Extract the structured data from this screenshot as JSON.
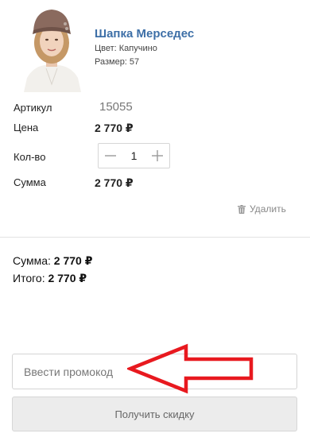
{
  "product": {
    "title": "Шапка Мерседес",
    "color": "Цвет: Капучино",
    "size": "Размер: 57"
  },
  "details": {
    "article_label": "Артикул",
    "article_value": "15055",
    "price_label": "Цена",
    "price_value": "2 770 ₽",
    "qty_label": "Кол-во",
    "qty_value": "1",
    "sum_label": "Сумма",
    "sum_value": "2 770 ₽"
  },
  "delete_label": "Удалить",
  "totals": {
    "sum_label": "Сумма:",
    "sum_value": "2 770 ₽",
    "total_label": "Итого:",
    "total_value": "2 770 ₽"
  },
  "promo": {
    "placeholder": "Ввести промокод",
    "button_label": "Получить скидку"
  },
  "colors": {
    "title": "#3d6fa7",
    "arrow": "#e8191f",
    "button_bg": "#ececec"
  }
}
